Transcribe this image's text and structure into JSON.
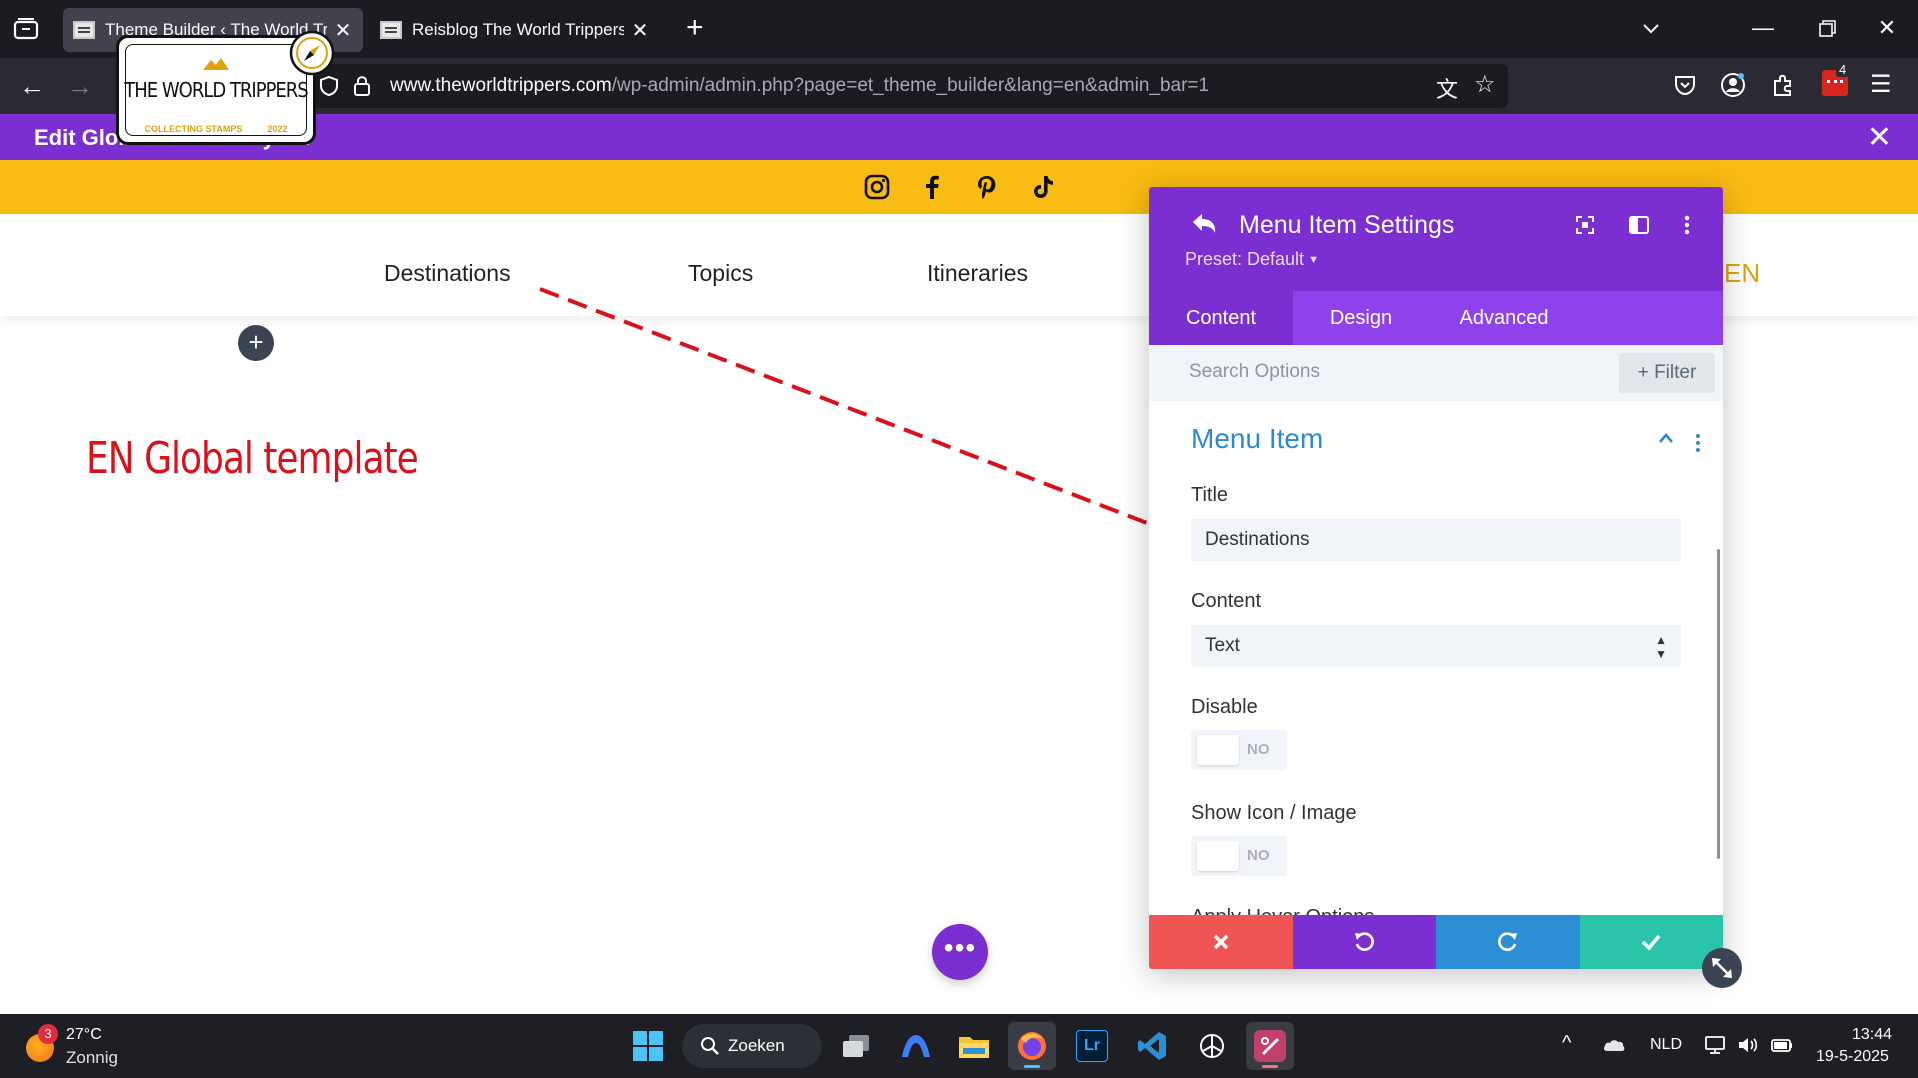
{
  "browser": {
    "tabs": [
      {
        "title": "Theme Builder ‹ The World Tripp",
        "active": true
      },
      {
        "title": "Reisblog The World Trippers. Vo",
        "active": false
      }
    ],
    "url_domain": "www.theworldtrippers.com",
    "url_path": "/wp-admin/admin.php?page=et_theme_builder&lang=en&admin_bar=1",
    "extension_badge": "4"
  },
  "divi_header": {
    "title": "Edit Global Header Layout"
  },
  "site": {
    "social_icons": [
      "instagram-icon",
      "facebook-icon",
      "pinterest-icon",
      "tiktok-icon"
    ],
    "logo": {
      "title": "THE WORLD TRIPPERS",
      "subtitle": "COLLECTING STAMPS",
      "year": "2022"
    },
    "menu": [
      "Destinations",
      "Topics",
      "Itineraries"
    ],
    "language": "EN"
  },
  "annotation": {
    "text": "EN Global template",
    "color": "#d8121b"
  },
  "modal": {
    "title": "Menu Item Settings",
    "preset": "Preset: Default",
    "tabs": [
      "Content",
      "Design",
      "Advanced"
    ],
    "active_tab": "Content",
    "search_placeholder": "Search Options",
    "filter_label": "Filter",
    "group_title": "Menu Item",
    "fields": {
      "title_label": "Title",
      "title_value": "Destinations",
      "content_label": "Content",
      "content_value": "Text",
      "disable_label": "Disable",
      "disable_value": "NO",
      "show_icon_label": "Show Icon / Image",
      "show_icon_value": "NO",
      "next_label_partial": "Apply Hover Options"
    },
    "footer_colors": {
      "cancel": "#ef5555",
      "undo": "#7b2fd0",
      "redo": "#2c8fd6",
      "save": "#29c4a9"
    }
  },
  "taskbar": {
    "weather_badge": "3",
    "temperature": "27°C",
    "weather": "Zonnig",
    "search_label": "Zoeken",
    "language": "NLD",
    "time": "13:44",
    "date": "19-5-2025"
  },
  "colors": {
    "divi_purple": "#7b2fd0",
    "site_yellow": "#f9bc14",
    "link_blue": "#2e8ad0"
  }
}
